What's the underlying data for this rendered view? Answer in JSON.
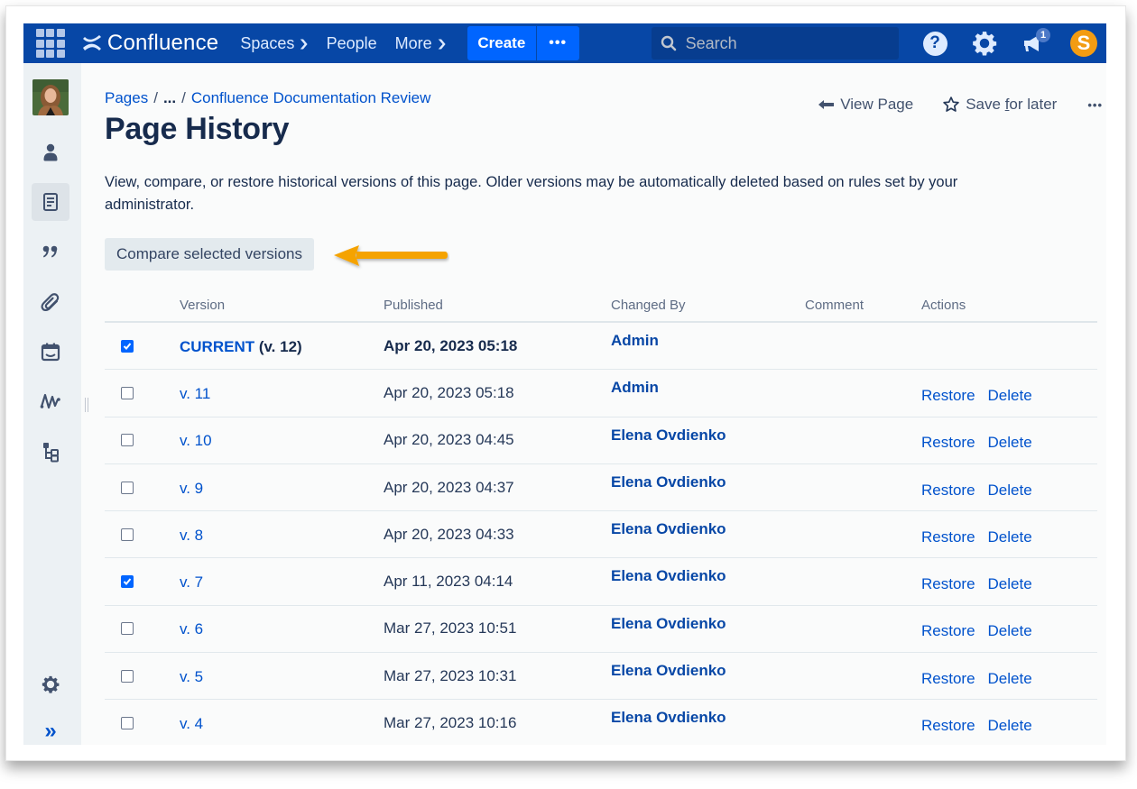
{
  "topnav": {
    "app_name": "Confluence",
    "items": [
      {
        "label": "Spaces",
        "has_dropdown": true
      },
      {
        "label": "People",
        "has_dropdown": false
      },
      {
        "label": "More",
        "has_dropdown": true
      }
    ],
    "create_label": "Create",
    "more_label": "•••",
    "search_placeholder": "Search",
    "help_label": "?",
    "notification_count": "1",
    "profile_initial": "S",
    "icons": [
      "app-switcher-icon",
      "confluence-logo-icon",
      "search-icon",
      "help-icon",
      "gear-icon",
      "megaphone-icon",
      "profile-avatar"
    ]
  },
  "sidebar": {
    "items": [
      {
        "name": "people",
        "icon": "person-icon"
      },
      {
        "name": "pages",
        "icon": "page-icon",
        "active": true
      },
      {
        "name": "blog",
        "icon": "quote-icon"
      },
      {
        "name": "attachments",
        "icon": "paperclip-icon"
      },
      {
        "name": "calendars",
        "icon": "calendar-icon"
      },
      {
        "name": "analytics",
        "icon": "activity-icon"
      },
      {
        "name": "hierarchy",
        "icon": "tree-icon"
      }
    ],
    "bottom": [
      {
        "name": "settings",
        "icon": "gear-icon"
      },
      {
        "name": "expand",
        "icon": "chevrons-right-icon",
        "label": "»"
      }
    ]
  },
  "breadcrumb": {
    "root": "Pages",
    "sep": "/",
    "ellipsis": "...",
    "parent": "Confluence Documentation Review"
  },
  "page": {
    "title": "Page History",
    "description": "View, compare, or restore historical versions of this page. Older versions may be automatically deleted based on rules set by your administrator.",
    "compare_button": "Compare selected versions"
  },
  "page_actions": {
    "view_page": "View Page",
    "save_for_later_pre": "Save ",
    "save_for_later_u": "f",
    "save_for_later_post": "or later",
    "more": "•••"
  },
  "table": {
    "headers": {
      "version": "Version",
      "published": "Published",
      "changed_by": "Changed By",
      "comment": "Comment",
      "actions": "Actions"
    },
    "restore_label": "Restore",
    "delete_label": "Delete",
    "rows": [
      {
        "checked": true,
        "version": "CURRENT",
        "suffix": " (v. 12)",
        "published": "Apr 20, 2023 05:18",
        "changed_by": "Admin",
        "comment": "",
        "current": true
      },
      {
        "checked": false,
        "version": "v. 11",
        "suffix": "",
        "published": "Apr 20, 2023 05:18",
        "changed_by": "Admin",
        "comment": ""
      },
      {
        "checked": false,
        "version": "v. 10",
        "suffix": "",
        "published": "Apr 20, 2023 04:45",
        "changed_by": "Elena Ovdienko",
        "comment": ""
      },
      {
        "checked": false,
        "version": "v. 9",
        "suffix": "",
        "published": "Apr 20, 2023 04:37",
        "changed_by": "Elena Ovdienko",
        "comment": ""
      },
      {
        "checked": false,
        "version": "v. 8",
        "suffix": "",
        "published": "Apr 20, 2023 04:33",
        "changed_by": "Elena Ovdienko",
        "comment": ""
      },
      {
        "checked": true,
        "version": "v. 7",
        "suffix": "",
        "published": "Apr 11, 2023 04:14",
        "changed_by": "Elena Ovdienko",
        "comment": ""
      },
      {
        "checked": false,
        "version": "v. 6",
        "suffix": "",
        "published": "Mar 27, 2023 10:51",
        "changed_by": "Elena Ovdienko",
        "comment": ""
      },
      {
        "checked": false,
        "version": "v. 5",
        "suffix": "",
        "published": "Mar 27, 2023 10:31",
        "changed_by": "Elena Ovdienko",
        "comment": ""
      },
      {
        "checked": false,
        "version": "v. 4",
        "suffix": "",
        "published": "Mar 27, 2023 10:16",
        "changed_by": "Elena Ovdienko",
        "comment": ""
      }
    ]
  },
  "annotation": {
    "arrow_color": "#f5a300",
    "points_to": "compare-selected-versions-button"
  },
  "colors": {
    "nav_bg": "#0747a6",
    "create_bg": "#0065ff",
    "link": "#0052cc",
    "sidebar_bg": "#ecf1f4"
  }
}
